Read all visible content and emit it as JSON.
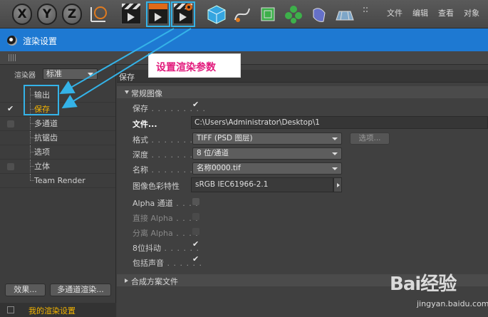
{
  "toolbar": {
    "axis_buttons": [
      "X",
      "Y",
      "Z"
    ],
    "menu": [
      "文件",
      "编辑",
      "查看",
      "对象"
    ]
  },
  "window": {
    "title": "渲染设置"
  },
  "left": {
    "renderer_label": "渲染器",
    "renderer_value": "标准",
    "tree": [
      {
        "label": "输出",
        "checked": false,
        "selected": false
      },
      {
        "label": "保存",
        "checked": true,
        "selected": true
      },
      {
        "label": "多通道",
        "checked": false,
        "selected": false
      },
      {
        "label": "抗锯齿",
        "checked": false,
        "selected": false
      },
      {
        "label": "选项",
        "checked": false,
        "selected": false
      },
      {
        "label": "立体",
        "checked": false,
        "selected": false
      },
      {
        "label": "Team Render",
        "checked": false,
        "selected": false
      }
    ],
    "effects_button": "效果...",
    "multipass_button": "多通道渲染...",
    "my_settings": "我的渲染设置"
  },
  "right": {
    "header": "保存",
    "section_regular": "常规图像",
    "rows": {
      "save_label": "保存",
      "file_label": "文件...",
      "file_value": "C:\\Users\\Administrator\\Desktop\\1",
      "format_label": "格式",
      "format_value": "TIFF (PSD 图层)",
      "options_button": "选项...",
      "depth_label": "深度",
      "depth_value": "8 位/通道",
      "name_label": "名称",
      "name_value": "名称0000.tif",
      "color_profile_label": "图像色彩特性",
      "color_profile_value": "sRGB IEC61966-2.1",
      "alpha_label": "Alpha 通道",
      "straight_alpha_label": "直接 Alpha",
      "separate_alpha_label": "分离 Alpha",
      "dither_label": "8位抖动",
      "sound_label": "包括声音"
    },
    "section_compositing": "合成方案文件"
  },
  "annotation": {
    "text": "设置渲染参数",
    "color": "#e2197c",
    "highlight_color": "#34b3e8"
  },
  "watermark": {
    "logo": "Bai经验",
    "url": "jingyan.baidu.com"
  }
}
